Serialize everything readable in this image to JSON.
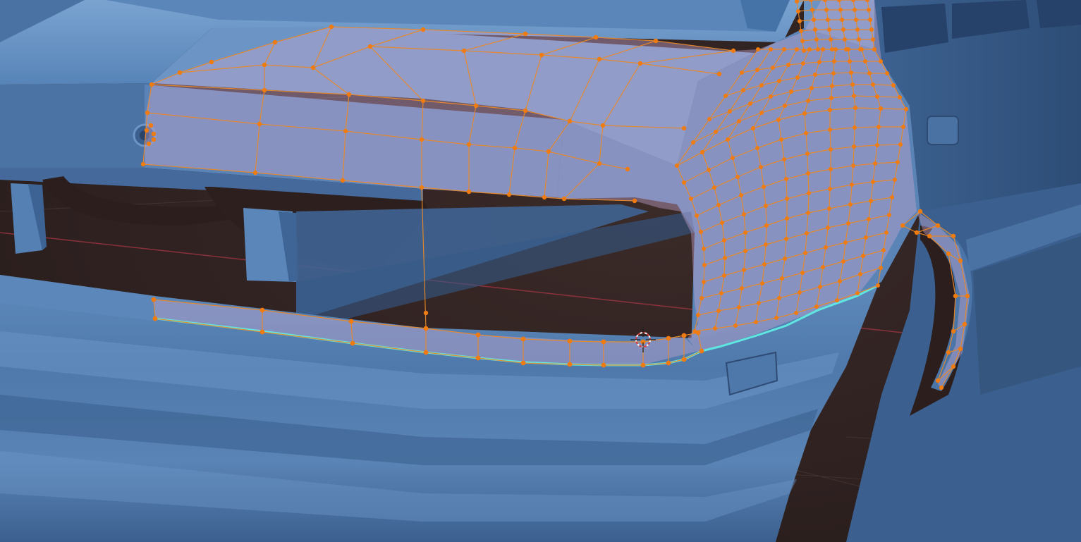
{
  "viewport": {
    "mode": "edit-mode",
    "object": "car-body-mesh",
    "background_color": "#2f2221",
    "icons": [
      "3d-cursor-icon",
      "vertex-icon"
    ]
  },
  "colors": {
    "background": "#2f2221",
    "grid": "#4a3a38",
    "axis_x": "#9a3540",
    "car_body": "#4f79ab",
    "car_body_light": "#6f99c8",
    "car_body_dark": "#2f4f78",
    "mesh_face": "#b8a4c8",
    "mesh_edge": "#e8892a",
    "vertex": "#f07b10",
    "active_edge": "#5fe6e0",
    "cursor_red": "#d43a3a",
    "cursor_white": "#ffffff"
  },
  "selection": {
    "active_edge_loop": "bumper-bottom-edge",
    "selected_vertices": true
  }
}
